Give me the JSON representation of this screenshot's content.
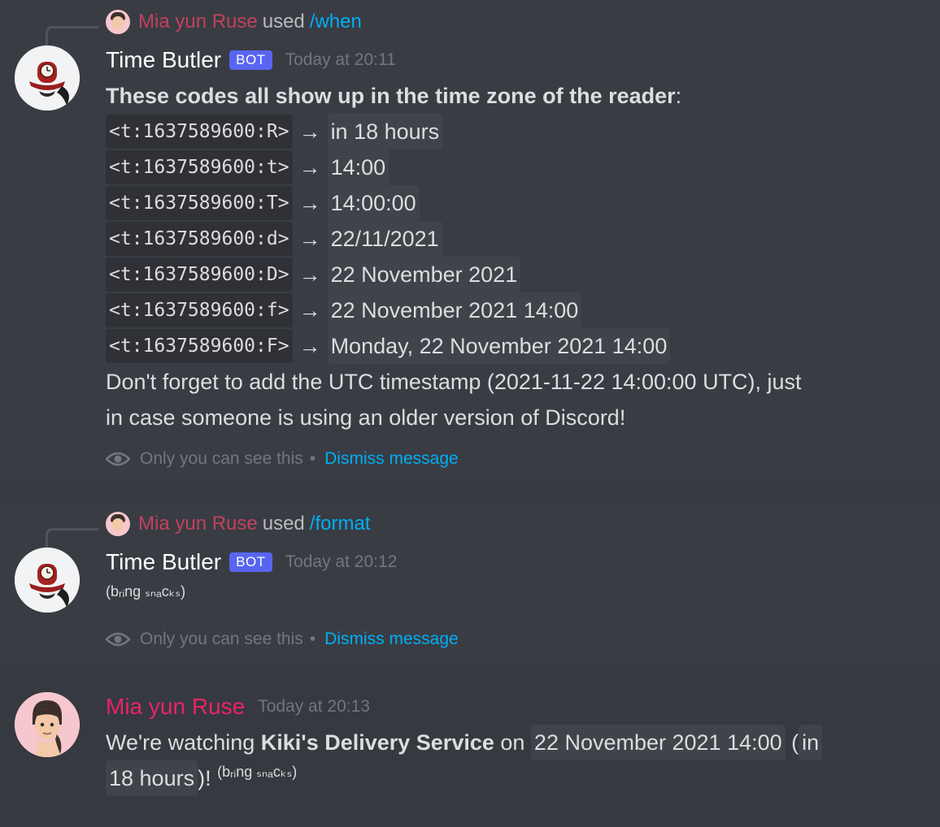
{
  "messages": [
    {
      "reply": {
        "user": "Mia yun Ruse",
        "used": "used",
        "command": "/when"
      },
      "author": "Time Butler",
      "tag": "BOT",
      "time": "Today at 20:11",
      "intro_bold": "These codes all show up in the time zone of the reader",
      "intro_colon": ":",
      "arrow": "→",
      "rows": [
        {
          "code": "<t:1637589600:R>",
          "result": "in 18 hours"
        },
        {
          "code": "<t:1637589600:t>",
          "result": "14:00"
        },
        {
          "code": "<t:1637589600:T>",
          "result": "14:00:00"
        },
        {
          "code": "<t:1637589600:d>",
          "result": "22/11/2021"
        },
        {
          "code": "<t:1637589600:D>",
          "result": "22 November 2021"
        },
        {
          "code": "<t:1637589600:f>",
          "result": "22 November 2021 14:00"
        },
        {
          "code": "<t:1637589600:F>",
          "result": "Monday, 22 November 2021 14:00"
        }
      ],
      "footer_line1": "Don't forget to add the UTC timestamp (2021-11-22 14:00:00 UTC), just",
      "footer_line2": "in case someone is using an older version of Discord!",
      "ephemeral_note": "Only you can see this",
      "bullet": "•",
      "dismiss": "Dismiss message"
    },
    {
      "reply": {
        "user": "Mia yun Ruse",
        "used": "used",
        "command": "/format"
      },
      "author": "Time Butler",
      "tag": "BOT",
      "time": "Today at 20:12",
      "text": "(bᵣᵢng ₛₙₐcₖₛ)",
      "ephemeral_note": "Only you can see this",
      "bullet": "•",
      "dismiss": "Dismiss message"
    },
    {
      "author": "Mia yun Ruse",
      "time": "Today at 20:13",
      "line1_pre": "We're watching ",
      "line1_bold": "Kiki's Delivery Service",
      "line1_on": " on ",
      "line1_ts": "22 November 2021 14:00",
      "line1_paren": " (",
      "line1_rel_a": "in",
      "line2_rel_b": "18 hours",
      "line2_close": ")! ",
      "line2_small": "(bᵣᵢng ₛₙₐcₖₛ)"
    }
  ]
}
